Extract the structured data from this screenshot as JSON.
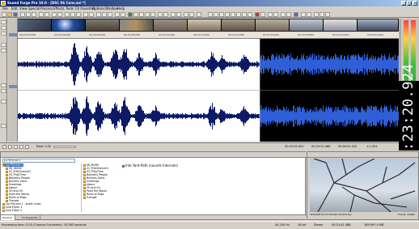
{
  "window": {
    "title": "Sound Forge Pro 10.0 - [DSC 06 Conv.avi *]",
    "colors": {
      "titlebar": "#0a246a",
      "waveform": "#0d1a66",
      "selection_bg": "#000000",
      "selection_wave": "#2f5fd6"
    }
  },
  "menu": [
    "File",
    "Edit",
    "View",
    "Special",
    "Process",
    "Effects",
    "Tools",
    "FX Favorites",
    "Options",
    "Window",
    "Help"
  ],
  "timeline": {
    "ticks": [
      "00:23:02.000",
      "00:23:04.000",
      "00:23:06.000",
      "00:23:08.000",
      "00:23:10.000",
      "00:23:12.000",
      "00:23:14.000",
      "00:23:16.000",
      "00:23:18.000",
      "00:23:20.000",
      "00:23:22.000"
    ]
  },
  "transport": {
    "rate": "Rate: 0.00",
    "position_start": "00:23:20.924",
    "position_end": "00:23:22.466",
    "position_length": "00:00:01.542",
    "zoom": "1:1,024"
  },
  "time_display": "00:23:20.924",
  "explorer": {
    "path": "Juo Pictures 1",
    "tree": [
      "Juo Pictures 1",
      "06_08002",
      "01_PrfAChannel1",
      "03_PhilsTime",
      "Beautiful People",
      "Bunkers Gone",
      "Greetings",
      "Jabour",
      "Oh and On",
      "Paint the Words",
      "Rules of Rags",
      "Triangle",
      "Juo Pictures 1 - sheet music",
      "Julia Ellyen 1",
      "Julia Ellyen 2"
    ],
    "files": [
      "06_MGR0",
      "01_PrfAChannel1",
      "03_PhilsTime",
      "Beautiful People",
      "Bunkers Gone",
      "Greetings",
      "Jabour",
      "Oh and On",
      "Paint the Words",
      "Rules of Rags",
      "Triangle"
    ],
    "files2": [
      "Into Yard-Path (sounds Intervals)"
    ],
    "tabs": [
      "Explorer",
      "FX Properties"
    ]
  },
  "preview": {
    "info_left": "404x228 00:23:20.924 29.970 fps",
    "info_right": "Frame: 41969"
  },
  "status": {
    "left": "Processing time: 0.00 (Channel Converter): 33,363 seconds",
    "right": [
      "44,100 Hz",
      "16 bit",
      "Stereo",
      "00:23:41.488",
      "169,997.0 MB"
    ]
  }
}
